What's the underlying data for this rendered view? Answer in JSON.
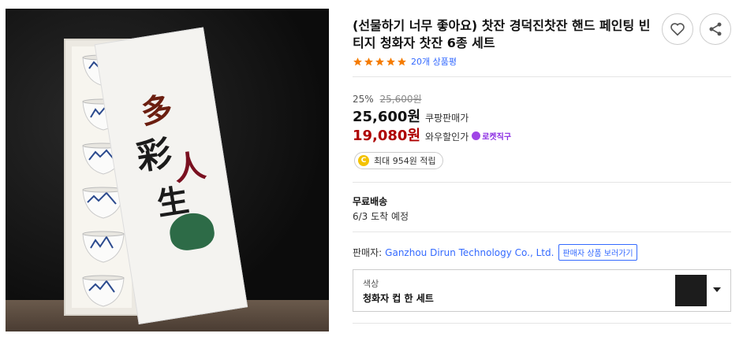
{
  "product": {
    "title": "(선물하기 너무 좋아요) 찻잔 경덕진찻잔 핸드 페인팅 빈티지 청화자 찻잔 6종 세트",
    "rating_stars": 5,
    "review_count_label": "20개 상품평",
    "image_calligraphy": [
      "多",
      "彩",
      "人",
      "生"
    ]
  },
  "actions": {
    "wishlist_icon": "heart-outline-icon",
    "share_icon": "share-icon"
  },
  "pricing": {
    "discount_rate": "25%",
    "original_price": "25,600원",
    "coupang_price": "25,600원",
    "coupang_label": "쿠팡판매가",
    "wow_price": "19,080원",
    "wow_label": "와우할인가",
    "rocket_badge": "로켓직구",
    "point_badge": "최대 954원 적립",
    "point_icon": "C"
  },
  "shipping": {
    "title": "무료배송",
    "arrival": "6/3 도착 예정"
  },
  "seller": {
    "label": "판매자:",
    "name": "Ganzhou Dirun Technology Co., Ltd.",
    "store_button": "판매자 상품 보러가기"
  },
  "option": {
    "label": "색상",
    "value": "청화자 컵 한 세트"
  },
  "colors": {
    "accent_blue": "#346aff",
    "wow_red": "#ae0000",
    "star_orange": "#f57c00",
    "rocket_purple": "#8a2be2"
  }
}
